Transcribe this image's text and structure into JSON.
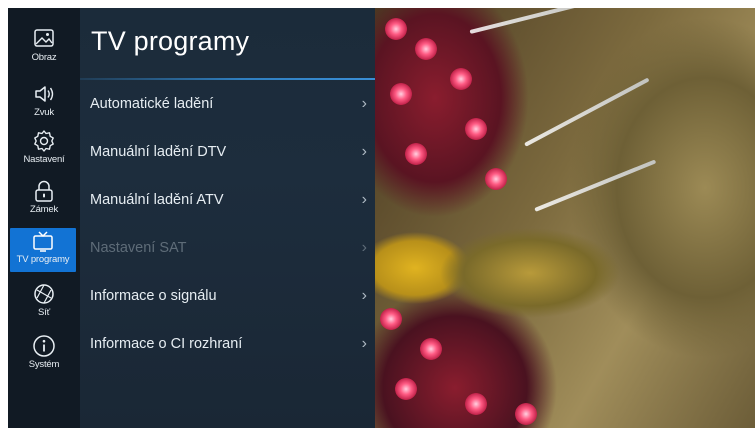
{
  "sidebar": {
    "items": [
      {
        "label": "Obraz",
        "icon": "picture-icon",
        "active": false
      },
      {
        "label": "Zvuk",
        "icon": "speaker-icon",
        "active": false
      },
      {
        "label": "Nastavení",
        "icon": "gear-icon",
        "active": false
      },
      {
        "label": "Zámek",
        "icon": "lock-icon",
        "active": false
      },
      {
        "label": "TV programy",
        "icon": "tv-icon",
        "active": true
      },
      {
        "label": "Síť",
        "icon": "globe-icon",
        "active": false
      },
      {
        "label": "Systém",
        "icon": "info-icon",
        "active": false
      }
    ],
    "active_color": "#1273d4"
  },
  "panel": {
    "title": "TV programy",
    "items": [
      {
        "label": "Automatické ladění",
        "enabled": true
      },
      {
        "label": "Manuální ladění DTV",
        "enabled": true
      },
      {
        "label": "Manuální ladění ATV",
        "enabled": true
      },
      {
        "label": "Nastavení SAT",
        "enabled": false
      },
      {
        "label": "Informace o signálu",
        "enabled": true
      },
      {
        "label": "Informace o CI rozhraní",
        "enabled": true
      }
    ],
    "chevron": "›"
  }
}
